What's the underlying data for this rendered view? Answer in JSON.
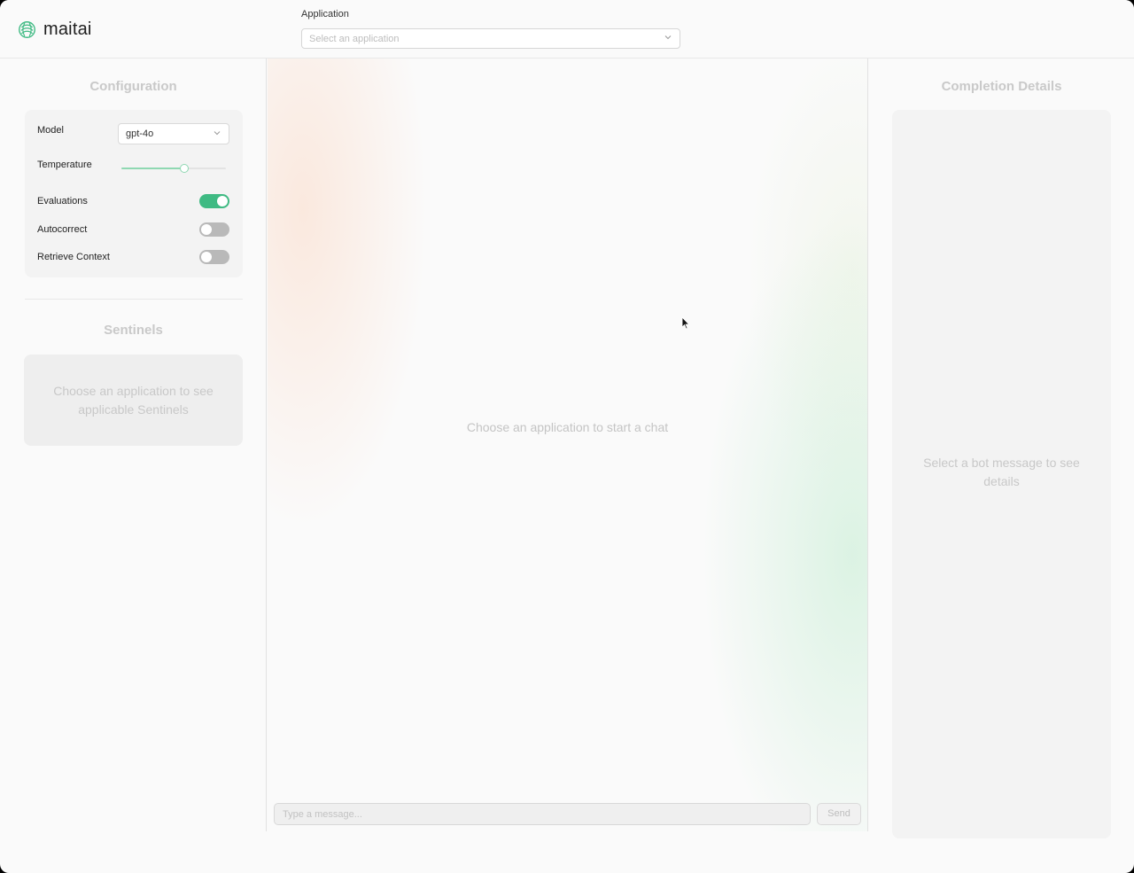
{
  "header": {
    "brand": "maitai",
    "application_label": "Application",
    "application_placeholder": "Select an application"
  },
  "configuration": {
    "title": "Configuration",
    "model_label": "Model",
    "model_value": "gpt-4o",
    "temperature_label": "Temperature",
    "temperature_level": 0.6,
    "toggles": [
      {
        "label": "Evaluations",
        "on": true
      },
      {
        "label": "Autocorrect",
        "on": false
      },
      {
        "label": "Retrieve Context",
        "on": false
      }
    ]
  },
  "sentinels": {
    "title": "Sentinels",
    "empty_text": "Choose an application to see applicable Sentinels"
  },
  "chat": {
    "empty_text": "Choose an application to start a chat",
    "input_placeholder": "Type a message...",
    "send_label": "Send"
  },
  "details": {
    "title": "Completion Details",
    "empty_text": "Select a bot message to see details"
  },
  "colors": {
    "accent": "#3fba83",
    "slider": "#8fd8b2"
  },
  "icons": {
    "logo": "maitai-logo-icon",
    "dropdown": "chevron-down-icon",
    "cursor": "mouse-pointer-icon"
  }
}
